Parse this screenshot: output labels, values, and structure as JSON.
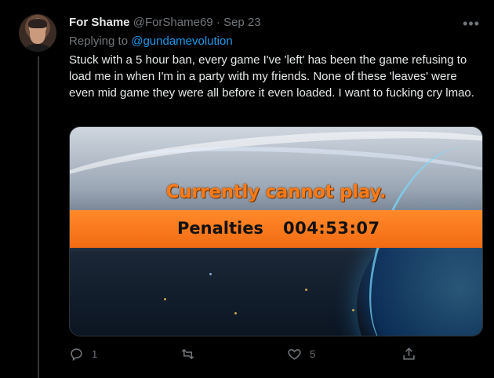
{
  "tweet": {
    "display_name": "For Shame",
    "handle": "@ForShame69",
    "separator": "·",
    "date": "Sep 23",
    "more_icon": "more-horizontal-icon",
    "replying_prefix": "Replying to",
    "replying_handle": "@gundamevolution",
    "text": "Stuck with a 5 hour ban, every game I've 'left' has been the game refusing to load me in when I'm in a party with my friends.  None of these 'leaves' were even mid game they were all before it even loaded.  I want to fucking cry lmao."
  },
  "media": {
    "title": "Currently cannot play.",
    "penalty_label": "Penalties",
    "penalty_time": "004:53:07",
    "accent_color": "#f36b12"
  },
  "actions": {
    "reply_count": "1",
    "retweet_count": "",
    "like_count": "5"
  },
  "colors": {
    "background": "#000000",
    "text": "#e7e9ea",
    "muted": "#71767b",
    "link": "#1d9bf0"
  }
}
